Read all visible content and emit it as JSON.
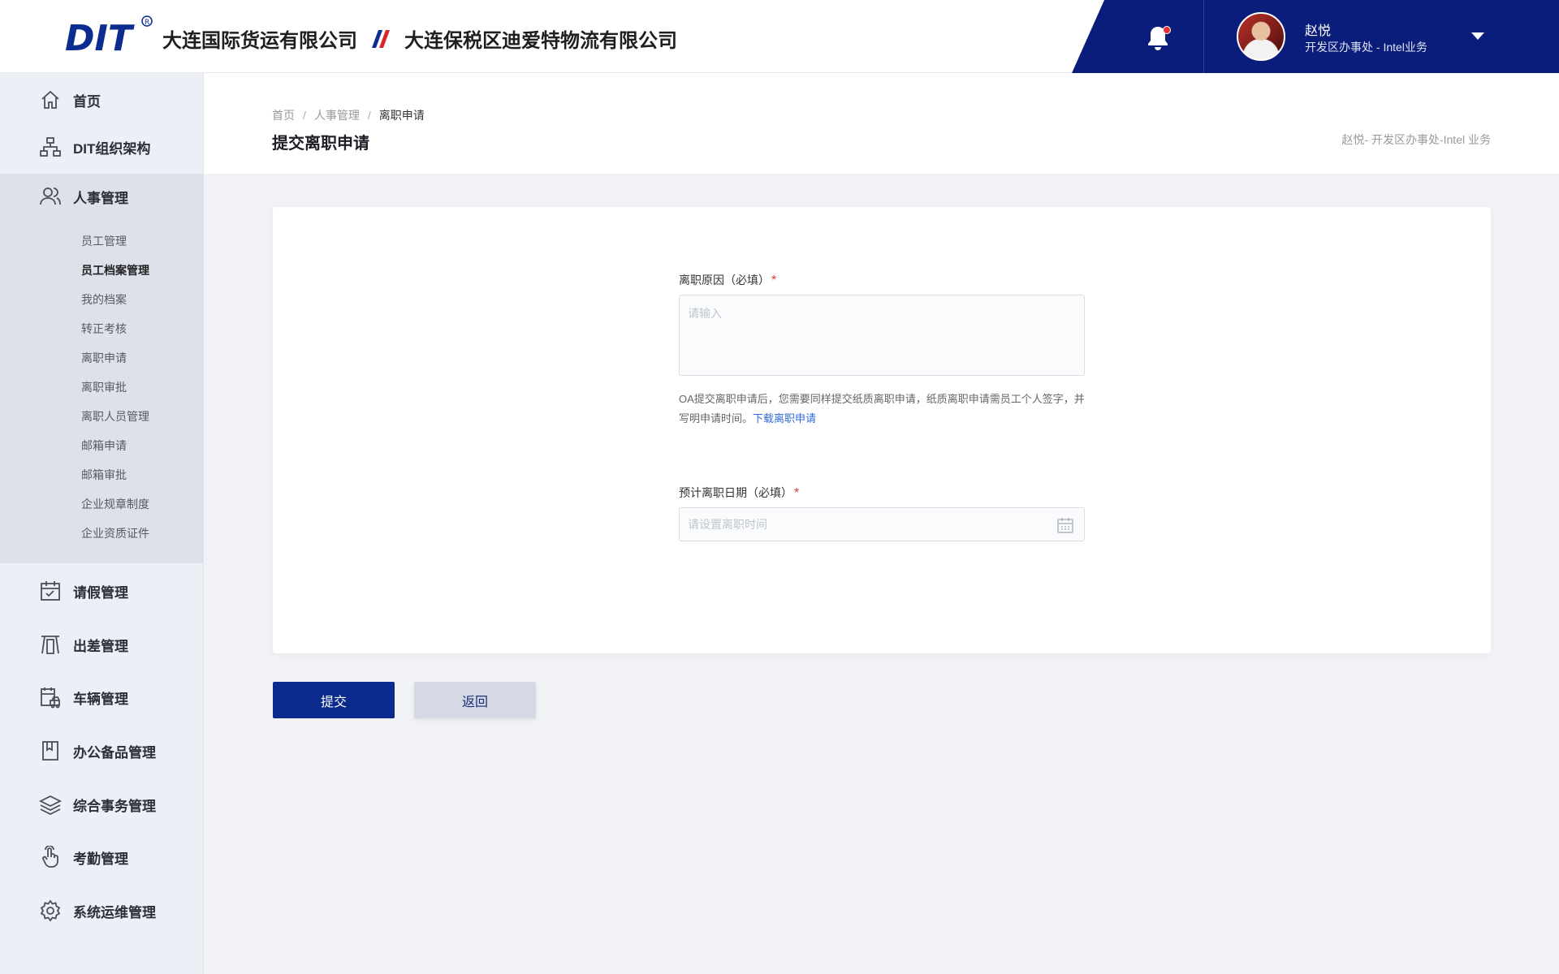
{
  "header": {
    "logo_text": "DIT",
    "company_1": "大连国际货运有限公司",
    "company_2": "大连保税区迪爱特物流有限公司",
    "user_name": "赵悦",
    "user_dept": "开发区办事处 - Intel业务"
  },
  "sidebar": {
    "items": [
      {
        "label": "首页",
        "icon": "home-icon"
      },
      {
        "label": "DIT组织架构",
        "icon": "org-chart-icon"
      },
      {
        "label": "人事管理",
        "icon": "users-icon"
      },
      {
        "label": "请假管理",
        "icon": "calendar-check-icon"
      },
      {
        "label": "出差管理",
        "icon": "travel-icon"
      },
      {
        "label": "车辆管理",
        "icon": "vehicle-icon"
      },
      {
        "label": "办公备品管理",
        "icon": "bookmark-icon"
      },
      {
        "label": "综合事务管理",
        "icon": "layers-icon"
      },
      {
        "label": "考勤管理",
        "icon": "touch-icon"
      },
      {
        "label": "系统运维管理",
        "icon": "gear-icon"
      }
    ],
    "sub_items": [
      {
        "label": "员工管理"
      },
      {
        "label": "员工档案管理",
        "active": true
      },
      {
        "label": "我的档案"
      },
      {
        "label": "转正考核"
      },
      {
        "label": "离职申请"
      },
      {
        "label": "离职审批"
      },
      {
        "label": "离职人员管理"
      },
      {
        "label": "邮箱申请"
      },
      {
        "label": "邮箱审批"
      },
      {
        "label": "企业规章制度"
      },
      {
        "label": "企业资质证件"
      }
    ]
  },
  "page": {
    "breadcrumb": [
      "首页",
      "人事管理",
      "离职申请"
    ],
    "breadcrumb_sep": "/",
    "title": "提交离职申请",
    "user_info": "赵悦- 开发区办事处-Intel 业务"
  },
  "form": {
    "reason_label": "离职原因（必填）",
    "required_mark": "*",
    "reason_placeholder": "请输入",
    "reason_value": "",
    "note_text": "OA提交离职申请后，您需要同样提交纸质离职申请，纸质离职申请需员工个人签字，并写明申请时间。",
    "note_link": "下载离职申请",
    "date_label": "预计离职日期（必填）",
    "date_placeholder": "请设置离职时间",
    "date_value": ""
  },
  "buttons": {
    "submit": "提交",
    "back": "返回"
  },
  "colors": {
    "brand_navy": "#0b1d7a",
    "primary_button": "#0a2a8c",
    "link": "#2f6bd9",
    "required": "#e53935",
    "notification_dot": "#e5312f"
  }
}
